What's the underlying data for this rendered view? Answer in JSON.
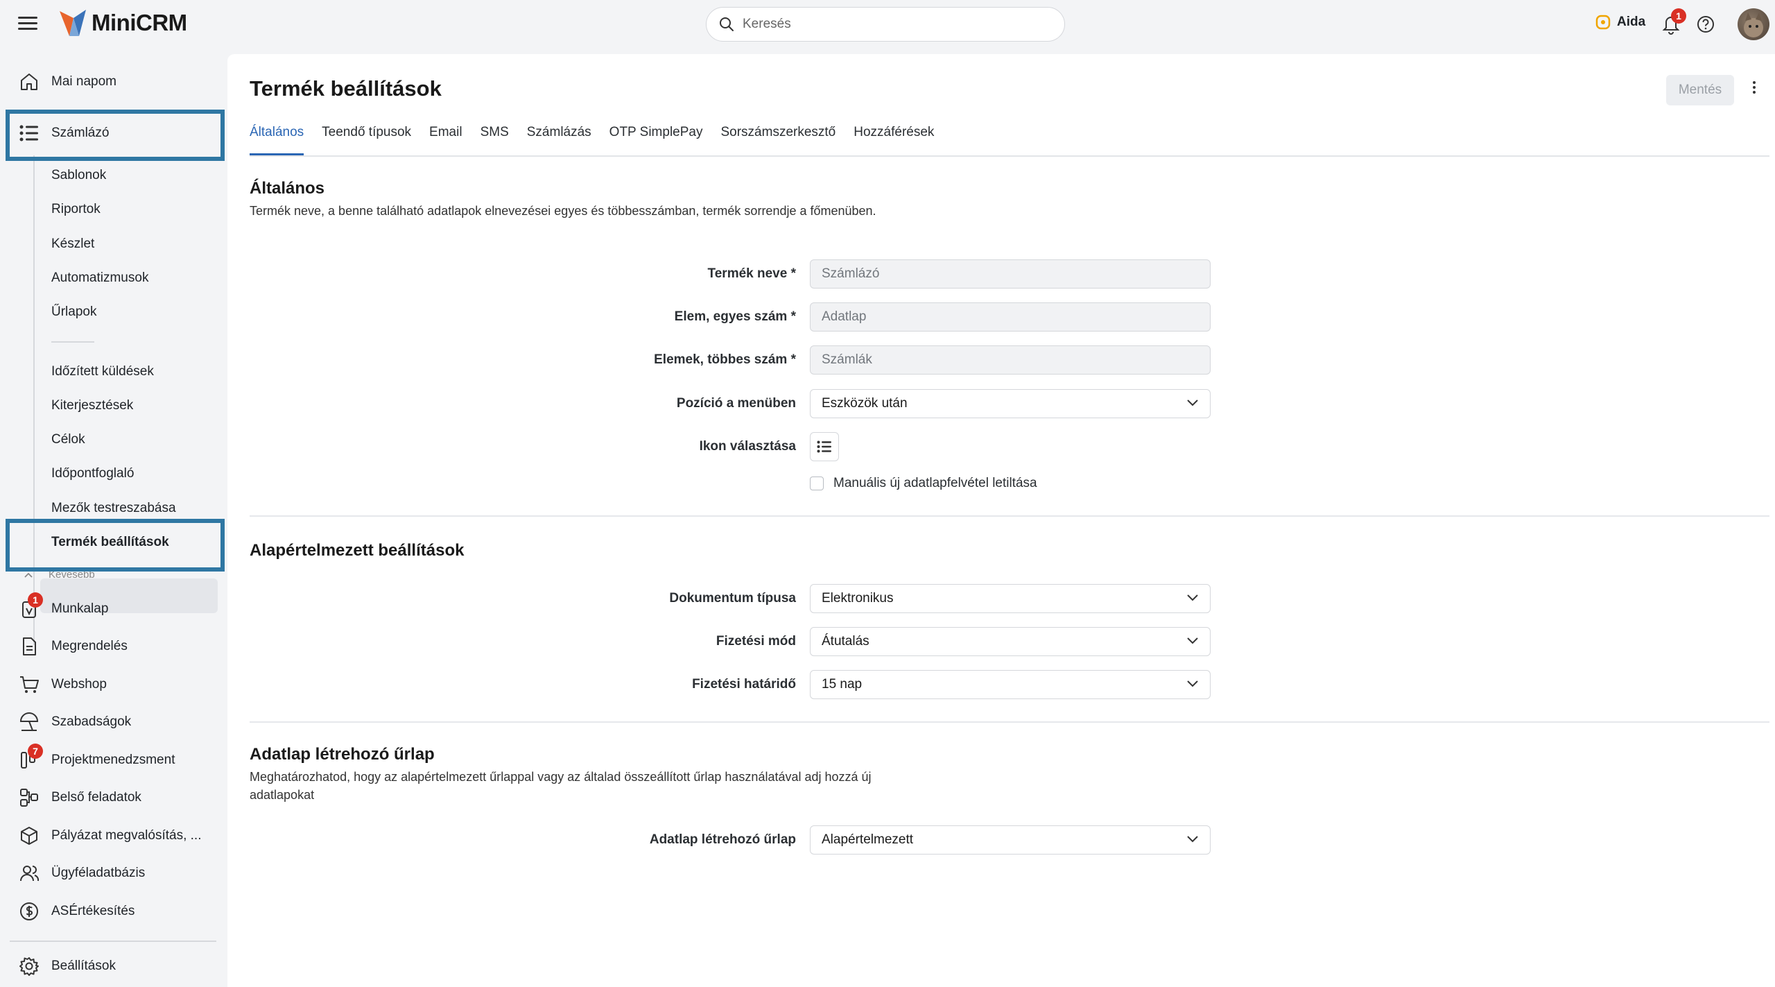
{
  "app": {
    "name": "MiniCRM"
  },
  "header": {
    "search_placeholder": "Keresés",
    "aida_label": "Aida",
    "notification_count": "1"
  },
  "sidebar": {
    "top_item": "Mai napom",
    "current_module": "Számlázó",
    "sub_items": [
      "Sablonok",
      "Riportok",
      "Készlet",
      "Automatizmusok",
      "Űrlapok"
    ],
    "sub_items_2": [
      "Időzített küldések",
      "Kiterjesztések",
      "Célok",
      "Időpontfoglaló",
      "Mezők testreszabása",
      "Termék beállítások"
    ],
    "less_label": "Kevesebb",
    "modules": [
      {
        "label": "Munkalap",
        "badge": "1"
      },
      {
        "label": "Megrendelés"
      },
      {
        "label": "Webshop"
      },
      {
        "label": "Szabadságok"
      },
      {
        "label": "Projektmenedzsment",
        "badge": "7"
      },
      {
        "label": "Belső feladatok"
      },
      {
        "label": "Pályázat megvalósítás, ..."
      },
      {
        "label": "Ügyféladatbázis"
      },
      {
        "label": "ASÉrtékesítés"
      }
    ],
    "settings": "Beállítások"
  },
  "page": {
    "title": "Termék beállítások",
    "save_label": "Mentés",
    "tabs": [
      "Általános",
      "Teendő típusok",
      "Email",
      "SMS",
      "Számlázás",
      "OTP SimplePay",
      "Sorszámszerkesztő",
      "Hozzáférések"
    ]
  },
  "general": {
    "title": "Általános",
    "desc": "Termék neve, a benne található adatlapok elnevezései egyes és többesszámban, termék sorrendje a főmenüben.",
    "product_name_label": "Termék neve *",
    "product_name_value": "Számlázó",
    "singular_label": "Elem, egyes szám *",
    "singular_value": "Adatlap",
    "plural_label": "Elemek, többes szám *",
    "plural_value": "Számlák",
    "position_label": "Pozíció a menüben",
    "position_value": "Eszközök után",
    "icon_label": "Ikon választása",
    "manual_disable_label": "Manuális új adatlapfelvétel letiltása"
  },
  "defaults": {
    "title": "Alapértelmezett beállítások",
    "doc_type_label": "Dokumentum típusa",
    "doc_type_value": "Elektronikus",
    "payment_label": "Fizetési mód",
    "payment_value": "Átutalás",
    "deadline_label": "Fizetési határidő",
    "deadline_value": "15 nap"
  },
  "form": {
    "title": "Adatlap létrehozó űrlap",
    "desc": "Meghatározhatod, hogy az alapértelmezett űrlappal vagy az általad összeállított űrlap használatával adj hozzá új adatlapokat",
    "form_label": "Adatlap létrehozó űrlap",
    "form_value": "Alapértelmezett"
  },
  "colors": {
    "accent": "#2b66b4",
    "highlight": "#2f77a3",
    "badge": "#d93025"
  }
}
